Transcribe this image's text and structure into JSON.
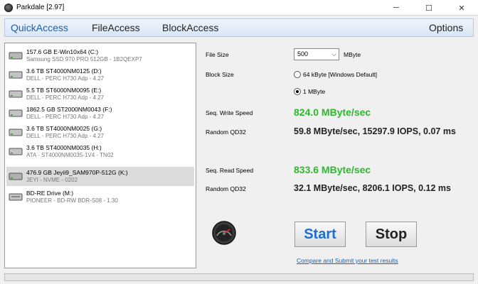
{
  "window": {
    "title": "Parkdale [2.97]",
    "minimize": "─",
    "maximize": "☐",
    "close": "✕"
  },
  "menu": {
    "quick": "QuickAccess",
    "file": "FileAccess",
    "block": "BlockAccess",
    "options": "Options"
  },
  "drives": [
    {
      "name": "157.6 GB E-Win10x64 (C:)",
      "sub": "Samsung SSD 970 PRO 512GB - 1B2QEXP7",
      "icon": "ssd-icon"
    },
    {
      "name": "3.6 TB ST4000NM0125 (D:)",
      "sub": "DELL - PERC H730 Adp - 4.27",
      "icon": "hdd-icon"
    },
    {
      "name": "5.5 TB ST6000NM0095 (E:)",
      "sub": "DELL - PERC H730 Adp - 4.27",
      "icon": "hdd-icon"
    },
    {
      "name": "1862.5 GB ST2000NM0043 (F:)",
      "sub": "DELL - PERC H730 Adp - 4.27",
      "icon": "hdd-icon"
    },
    {
      "name": "3.6 TB ST4000NM0025 (G:)",
      "sub": "DELL - PERC H730 Adp - 4.27",
      "icon": "hdd-icon"
    },
    {
      "name": "3.6 TB ST4000NM0035 (H:)",
      "sub": "ATA - ST4000NM0035-1V4 - TN02",
      "icon": "hdd-icon"
    },
    {
      "name": "476.9 GB Jeyii9_SAM970P-512G (K:)",
      "sub": "JEYI - NVME - 0202",
      "icon": "usb-drive-icon",
      "selected": true
    },
    {
      "name": "BD-RE Drive (M:)",
      "sub": "PIONEER - BD-RW   BDR-S08 - 1.30",
      "icon": "optical-drive-icon"
    }
  ],
  "settings": {
    "file_size_label": "File Size",
    "file_size_value": "500",
    "file_size_unit": "MByte",
    "block_size_label": "Block Size",
    "block_option_1": "64 kByte [Windows Default]",
    "block_option_2": "1 MByte",
    "selected_block": "1 MByte"
  },
  "results": {
    "write_label": "Seq. Write Speed",
    "write_value": "824.0 MByte/sec",
    "write_qd_label": "Random QD32",
    "write_qd_value": "59.8 MByte/sec, 15297.9 IOPS, 0.07 ms",
    "read_label": "Seq. Read Speed",
    "read_value": "833.6 MByte/sec",
    "read_qd_label": "Random QD32",
    "read_qd_value": "32.1 MByte/sec, 8206.1 IOPS, 0.12 ms"
  },
  "actions": {
    "start": "Start",
    "stop": "Stop",
    "link": "Compare and Submit your test results"
  },
  "colors": {
    "accent": "#1a5fb4",
    "result_green": "#2db82d"
  }
}
